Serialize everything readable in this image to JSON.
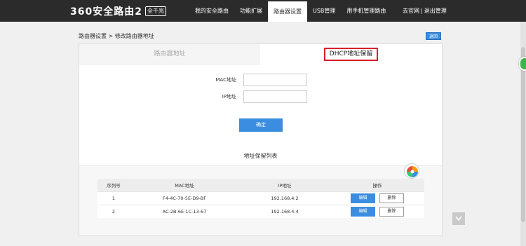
{
  "header": {
    "logo_text": "360安全路由2",
    "logo_badge": "全千兆",
    "nav": [
      "我的安全路由",
      "功能扩展",
      "路由器设置",
      "USB管理",
      "用手机管理路由"
    ],
    "link_official": "去官网",
    "separator": "|",
    "link_logout": "退出管理"
  },
  "breadcrumb": "路由器设置 > 修改路由器地址",
  "back_label": "返回",
  "tabs": {
    "tab1": "路由器地址",
    "tab2": "DHCP地址保留"
  },
  "form": {
    "mac_label": "MAC地址",
    "mac_value": "",
    "ip_label": "IP地址",
    "ip_value": "",
    "confirm_label": "确定"
  },
  "list": {
    "title": "地址保留列表",
    "headers": [
      "序列号",
      "MAC地址",
      "IP地址",
      "操作"
    ],
    "rows": [
      {
        "index": "1",
        "mac": "F4-4C-70-5E-D9-BF",
        "ip": "192.168.4.2",
        "edit": "编辑",
        "delete": "删除"
      },
      {
        "index": "2",
        "mac": "AC-2B-6E-1C-13-67",
        "ip": "192.168.4.4",
        "edit": "编辑",
        "delete": "删除"
      }
    ]
  },
  "colors": {
    "topbar": "#2b2b2b",
    "accent_blue": "#3b8de0",
    "highlight_red": "#d9202a"
  }
}
